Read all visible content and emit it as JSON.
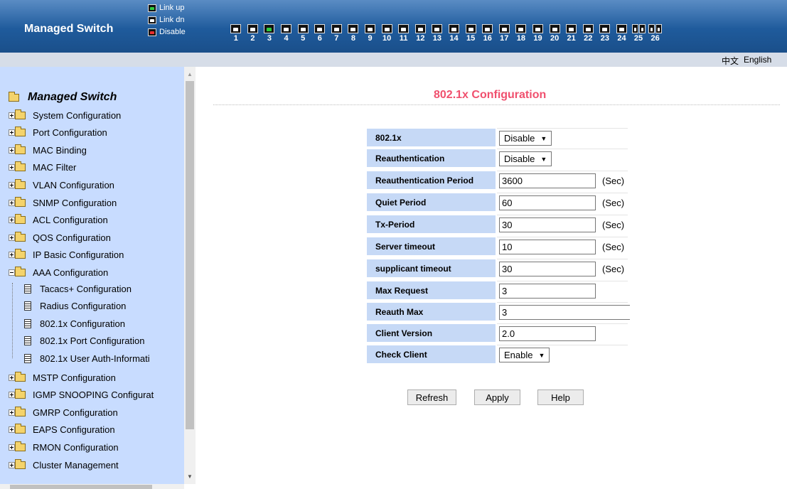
{
  "header": {
    "brand": "Managed Switch",
    "legend": [
      {
        "label": "Link up",
        "state": "up"
      },
      {
        "label": "Link dn",
        "state": "dn"
      },
      {
        "label": "Disable",
        "state": "dis"
      }
    ],
    "ports": [
      {
        "num": "1",
        "state": "dn"
      },
      {
        "num": "2",
        "state": "dn"
      },
      {
        "num": "3",
        "state": "up"
      },
      {
        "num": "4",
        "state": "dn"
      },
      {
        "num": "5",
        "state": "dn"
      },
      {
        "num": "6",
        "state": "dn"
      },
      {
        "num": "7",
        "state": "dn"
      },
      {
        "num": "8",
        "state": "dn"
      },
      {
        "num": "9",
        "state": "dn"
      },
      {
        "num": "10",
        "state": "dn"
      },
      {
        "num": "11",
        "state": "dn"
      },
      {
        "num": "12",
        "state": "dn"
      },
      {
        "num": "13",
        "state": "dn"
      },
      {
        "num": "14",
        "state": "dn"
      },
      {
        "num": "15",
        "state": "dn"
      },
      {
        "num": "16",
        "state": "dn"
      },
      {
        "num": "17",
        "state": "dn"
      },
      {
        "num": "18",
        "state": "dn"
      },
      {
        "num": "19",
        "state": "dn"
      },
      {
        "num": "20",
        "state": "dn"
      },
      {
        "num": "21",
        "state": "dn"
      },
      {
        "num": "22",
        "state": "dn"
      },
      {
        "num": "23",
        "state": "dn"
      },
      {
        "num": "24",
        "state": "dn"
      },
      {
        "num": "25",
        "state": "dn",
        "double": true
      },
      {
        "num": "26",
        "state": "dn",
        "double": true
      }
    ],
    "colors": {
      "link_up": "#2ecc40",
      "link_dn": "#ffffff",
      "disable": "#e83030",
      "header_bg": "#1f5b9c"
    }
  },
  "lang": {
    "chinese": "中文",
    "english": "English"
  },
  "sidebar": {
    "root": "Managed Switch",
    "items": [
      {
        "label": "System Configuration"
      },
      {
        "label": "Port Configuration"
      },
      {
        "label": "MAC Binding"
      },
      {
        "label": "MAC Filter"
      },
      {
        "label": "VLAN Configuration"
      },
      {
        "label": "SNMP Configuration"
      },
      {
        "label": "ACL Configuration"
      },
      {
        "label": "QOS Configuration"
      },
      {
        "label": "IP Basic Configuration"
      },
      {
        "label": "AAA Configuration",
        "expanded": true
      },
      {
        "label": "MSTP Configuration"
      },
      {
        "label": "IGMP SNOOPING Configurat"
      },
      {
        "label": "GMRP Configuration"
      },
      {
        "label": "EAPS Configuration"
      },
      {
        "label": "RMON Configuration"
      },
      {
        "label": "Cluster Management"
      }
    ],
    "aaa_children": [
      {
        "label": "Tacacs+ Configuration"
      },
      {
        "label": "Radius Configuration"
      },
      {
        "label": "802.1x Configuration"
      },
      {
        "label": "802.1x Port Configuration"
      },
      {
        "label": "802.1x User Auth-Informati"
      }
    ]
  },
  "main": {
    "title": "802.1x Configuration",
    "rows": [
      {
        "label": "802.1x",
        "type": "select",
        "value": "Disable"
      },
      {
        "label": "Reauthentication",
        "type": "select",
        "value": "Disable"
      },
      {
        "label": "Reauthentication Period",
        "type": "input",
        "value": "3600",
        "unit": "(Sec)"
      },
      {
        "label": "Quiet Period",
        "type": "input",
        "value": "60",
        "unit": "(Sec)"
      },
      {
        "label": "Tx-Period",
        "type": "input",
        "value": "30",
        "unit": "(Sec)"
      },
      {
        "label": "Server timeout",
        "type": "input",
        "value": "10",
        "unit": "(Sec)"
      },
      {
        "label": "supplicant timeout",
        "type": "input",
        "value": "30",
        "unit": "(Sec)"
      },
      {
        "label": "Max Request",
        "type": "input",
        "value": "3"
      },
      {
        "label": "Reauth Max",
        "type": "input-wide",
        "value": "3"
      },
      {
        "label": "Client Version",
        "type": "input",
        "value": "2.0"
      },
      {
        "label": "Check Client",
        "type": "select",
        "value": "Enable"
      }
    ],
    "buttons": {
      "refresh": "Refresh",
      "apply": "Apply",
      "help": "Help"
    },
    "title_color": "#f0506e"
  }
}
